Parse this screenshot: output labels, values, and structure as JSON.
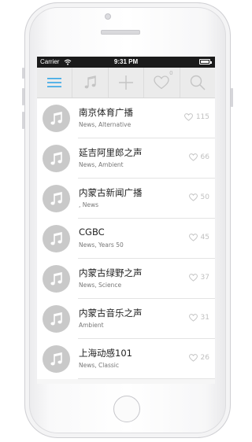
{
  "status_bar": {
    "carrier": "Carrier",
    "time": "9:31 PM"
  },
  "toolbar": {
    "items": [
      "menu-icon",
      "music-note-icon",
      "add-icon",
      "heart-icon",
      "search-icon"
    ],
    "favorites_count": "0"
  },
  "stations": [
    {
      "name": "南京体育广播",
      "genre": "News, Alternative",
      "likes": "115"
    },
    {
      "name": "延吉阿里郎之声",
      "genre": "News, Ambient",
      "likes": "66"
    },
    {
      "name": "内蒙古新闻广播",
      "genre": ", News",
      "likes": "50"
    },
    {
      "name": "CGBC",
      "genre": "News, Years 50",
      "likes": "45"
    },
    {
      "name": "内蒙古绿野之声",
      "genre": "News, Science",
      "likes": "37"
    },
    {
      "name": "内蒙古音乐之声",
      "genre": "Ambient",
      "likes": "31"
    },
    {
      "name": "上海动感101",
      "genre": "News, Classic",
      "likes": "26"
    }
  ],
  "colors": {
    "accent": "#36a6e6",
    "thumb": "#c9c9c9",
    "status_bar": "#1b1b1b",
    "toolbar": "#ebebeb"
  }
}
